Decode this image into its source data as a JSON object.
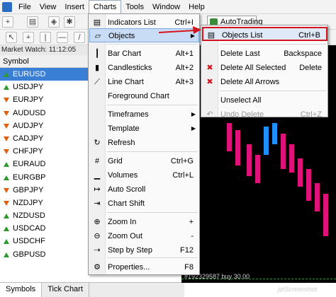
{
  "menubar": {
    "items": [
      "File",
      "View",
      "Insert",
      "Charts",
      "Tools",
      "Window",
      "Help"
    ]
  },
  "toolbar": {
    "autotrading_label": "AutoTrading"
  },
  "market_watch": {
    "title": "Market Watch: 11:12:05",
    "column_header": "Symbol",
    "symbols": [
      {
        "name": "EURUSD",
        "dir": "up"
      },
      {
        "name": "USDJPY",
        "dir": "up"
      },
      {
        "name": "EURJPY",
        "dir": "down"
      },
      {
        "name": "AUDUSD",
        "dir": "down"
      },
      {
        "name": "AUDJPY",
        "dir": "down"
      },
      {
        "name": "CADJPY",
        "dir": "down"
      },
      {
        "name": "CHFJPY",
        "dir": "down"
      },
      {
        "name": "EURAUD",
        "dir": "up"
      },
      {
        "name": "EURGBP",
        "dir": "up"
      },
      {
        "name": "GBPJPY",
        "dir": "down"
      },
      {
        "name": "NZDJPY",
        "dir": "down"
      },
      {
        "name": "NZDUSD",
        "dir": "up"
      },
      {
        "name": "USDCAD",
        "dir": "up"
      },
      {
        "name": "USDCHF",
        "dir": "up"
      },
      {
        "name": "GBPUSD",
        "dir": "up"
      }
    ],
    "tabs": [
      "Symbols",
      "Tick Chart"
    ]
  },
  "charts_menu": {
    "items": [
      {
        "label": "Indicators List",
        "shortcut": "Ctrl+I",
        "icon": "indicators-icon"
      },
      {
        "label": "Objects",
        "submenu": true,
        "icon": "objects-icon",
        "highlighted": true
      },
      {
        "label": "Bar Chart",
        "shortcut": "Alt+1",
        "icon": "bar-chart-icon"
      },
      {
        "label": "Candlesticks",
        "shortcut": "Alt+2",
        "icon": "candlesticks-icon"
      },
      {
        "label": "Line Chart",
        "shortcut": "Alt+3",
        "icon": "line-chart-icon"
      },
      {
        "label": "Foreground Chart",
        "icon": ""
      },
      {
        "label": "Timeframes",
        "submenu": true,
        "icon": ""
      },
      {
        "label": "Template",
        "submenu": true,
        "icon": ""
      },
      {
        "label": "Refresh",
        "icon": "refresh-icon"
      },
      {
        "label": "Grid",
        "shortcut": "Ctrl+G",
        "icon": "grid-icon"
      },
      {
        "label": "Volumes",
        "shortcut": "Ctrl+L",
        "icon": "volumes-icon"
      },
      {
        "label": "Auto Scroll",
        "icon": "auto-scroll-icon"
      },
      {
        "label": "Chart Shift",
        "icon": "chart-shift-icon"
      },
      {
        "label": "Zoom In",
        "shortcut": "+",
        "icon": "zoom-in-icon"
      },
      {
        "label": "Zoom Out",
        "shortcut": "-",
        "icon": "zoom-out-icon"
      },
      {
        "label": "Step by Step",
        "shortcut": "F12",
        "icon": "step-icon"
      },
      {
        "label": "Properties...",
        "shortcut": "F8",
        "icon": "properties-icon"
      }
    ]
  },
  "objects_submenu": {
    "items": [
      {
        "label": "Objects List",
        "shortcut": "Ctrl+B",
        "icon": "objects-list-icon"
      },
      {
        "label": "Delete Last",
        "shortcut": "Backspace",
        "icon": ""
      },
      {
        "label": "Delete All Selected",
        "shortcut": "Delete",
        "icon": "delete-selected-icon"
      },
      {
        "label": "Delete All Arrows",
        "shortcut": "",
        "icon": "delete-arrows-icon"
      },
      {
        "label": "Unselect All",
        "shortcut": "",
        "icon": ""
      },
      {
        "label": "Undo Delete",
        "shortcut": "Ctrl+Z",
        "icon": "undo-icon",
        "disabled": true
      }
    ]
  },
  "chart": {
    "status_text": "#192329587 buy 30.00",
    "watermark": "jetScreenshot"
  },
  "colors": {
    "bull_candle": "#1e90ff",
    "bear_candle": "#e0127a",
    "selection": "#3a7fd6",
    "highlight_box": "#d4141c"
  }
}
